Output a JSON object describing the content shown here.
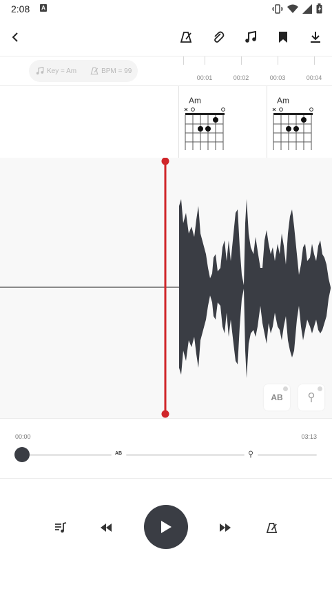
{
  "status_bar": {
    "time": "2:08",
    "notification_badge": "A",
    "icons": [
      "vibrate-icon",
      "wifi-icon",
      "signal-icon",
      "battery-icon"
    ]
  },
  "toolbar": {
    "icons": [
      "back-icon",
      "metronome-icon",
      "attachment-icon",
      "music-note-icon",
      "bookmark-icon",
      "download-icon"
    ]
  },
  "info": {
    "key_label": "Key = Am",
    "bpm_label": "BPM = 99"
  },
  "ruler": {
    "labels": [
      "00:01",
      "00:02",
      "00:03",
      "00:04"
    ]
  },
  "chords": [
    {
      "name": "Am"
    },
    {
      "name": "Am"
    }
  ],
  "waveform": {
    "ab_label": "AB",
    "playhead_color": "#d0262a",
    "wave_color": "#3a3d44"
  },
  "timeline": {
    "start_time": "00:00",
    "end_time": "03:13",
    "ab_marker": "AB",
    "progress": 0.0
  },
  "controls": {
    "icons": [
      "playlist-music-icon",
      "rewind-icon",
      "play-icon",
      "fast-forward-icon",
      "metronome-icon"
    ]
  },
  "colors": {
    "accent": "#d0262a",
    "dark": "#3a3d44"
  }
}
